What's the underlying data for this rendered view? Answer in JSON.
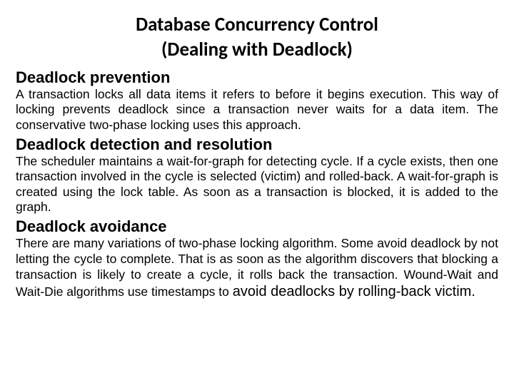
{
  "title": "Database Concurrency Control",
  "subtitle": "(Dealing with Deadlock)",
  "sections": {
    "prevention": {
      "heading": "Deadlock prevention",
      "body": "A transaction locks all data items it refers to before it begins execution.  This way of locking prevents deadlock since a transaction never waits for a data item.  The conservative two-phase locking uses this approach."
    },
    "detection": {
      "heading": "Deadlock detection and resolution",
      "body": "The scheduler maintains a wait-for-graph for detecting cycle.  If a cycle exists, then one transaction involved in the cycle is selected (victim) and rolled-back. A wait-for-graph is created using the lock table.  As soon as a transaction is blocked, it is added to the graph."
    },
    "avoidance": {
      "heading": "Deadlock avoidance",
      "body_part1": "There are many variations of two-phase locking algorithm.  Some avoid deadlock by not letting the cycle to complete.  That is as soon as the algorithm discovers that blocking a transaction is likely to create a cycle, it rolls back the transaction.  Wound-Wait and Wait-Die algorithms use timestamps to ",
      "body_part2": "avoid deadlocks by rolling-back victim."
    }
  }
}
